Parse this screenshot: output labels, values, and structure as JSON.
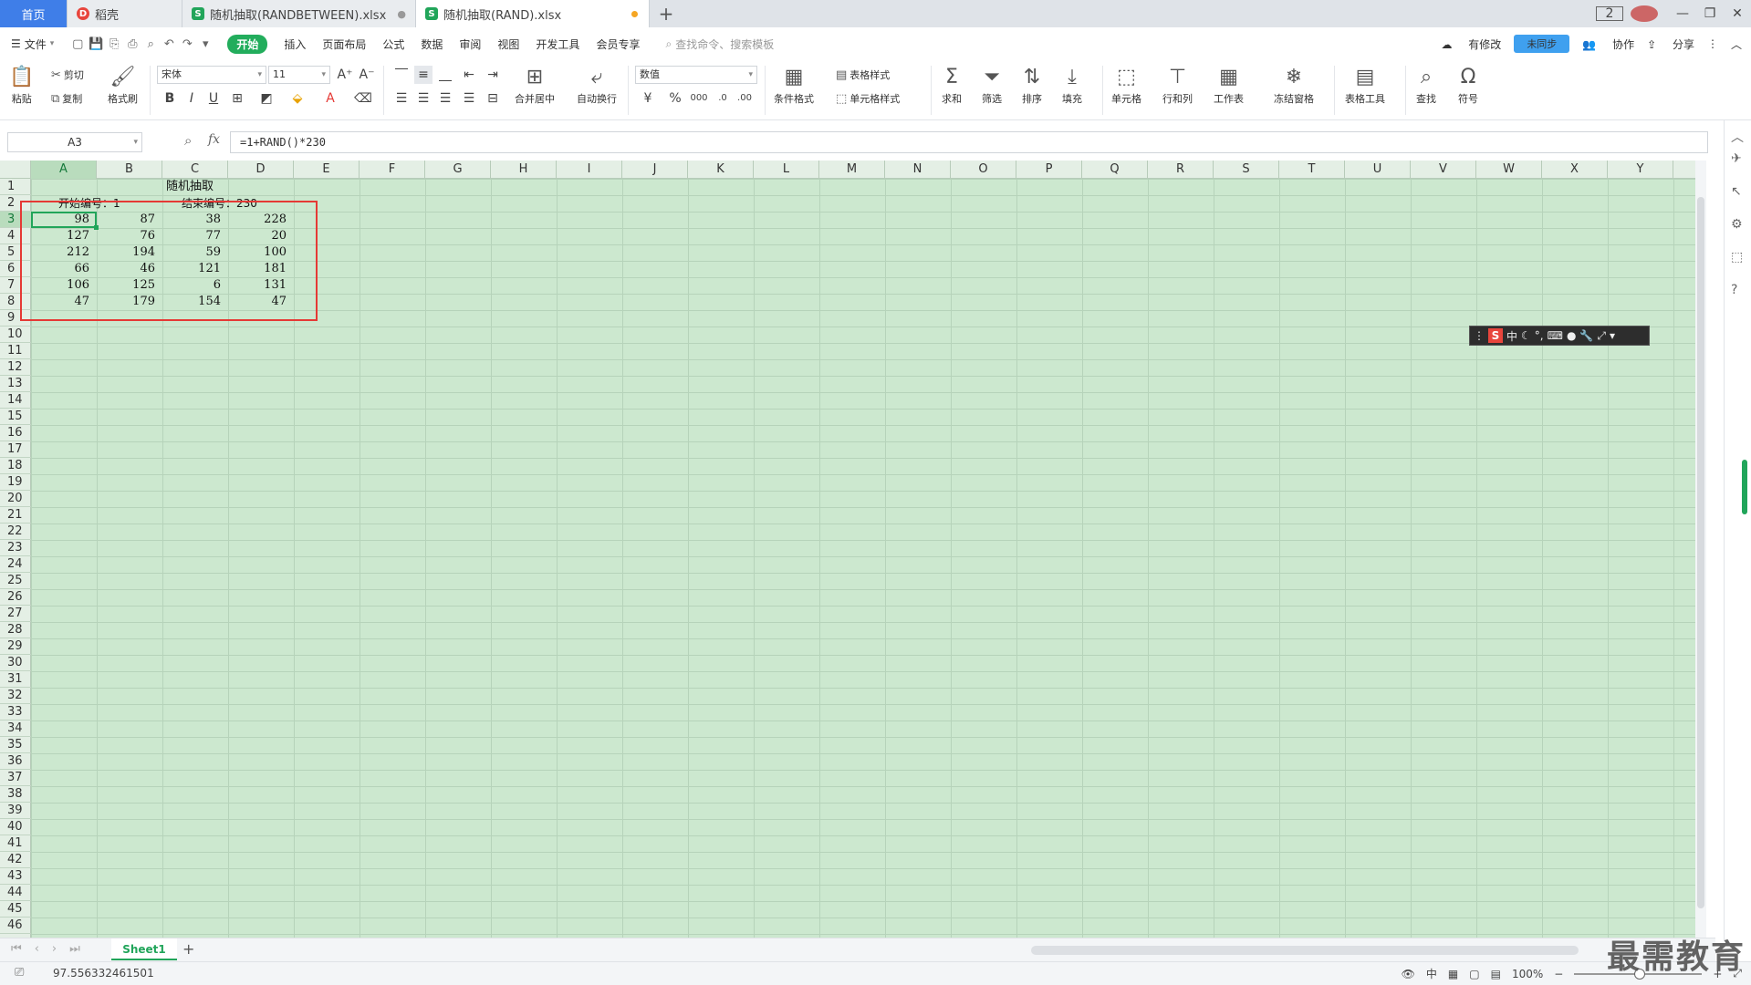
{
  "tabs": {
    "home": "首页",
    "daoke": "稻壳",
    "file1": "随机抽取(RANDBETWEEN).xlsx",
    "file2": "随机抽取(RAND).xlsx",
    "badge": "2"
  },
  "menu": {
    "file": "文件",
    "start": "开始",
    "items": [
      "插入",
      "页面布局",
      "公式",
      "数据",
      "审阅",
      "视图",
      "开发工具",
      "会员专享"
    ],
    "search": "查找命令、搜索模板",
    "cloud_label": "未同步",
    "sync": "有修改",
    "collab": "协作",
    "share": "分享"
  },
  "ribbon": {
    "paste": "粘贴",
    "cut": "剪切",
    "copy": "复制",
    "format_painter": "格式刷",
    "font_name": "宋体",
    "font_size": "11",
    "merge": "合并居中",
    "wrap": "自动换行",
    "number_format": "数值",
    "table_style": "表格样式",
    "cond_format": "条件格式",
    "cell_style": "单元格样式",
    "sum": "求和",
    "filter": "筛选",
    "sort": "排序",
    "fill": "填充",
    "cell": "单元格",
    "row_col": "行和列",
    "worksheet": "工作表",
    "freeze": "冻结窗格",
    "table_tools": "表格工具",
    "find": "查找",
    "symbol": "符号"
  },
  "formula_bar": {
    "name_box": "A3",
    "fx": "fx",
    "formula": "=1+RAND()*230"
  },
  "grid": {
    "columns": [
      "A",
      "B",
      "C",
      "D",
      "E",
      "F",
      "G",
      "H",
      "I",
      "J",
      "K",
      "L",
      "M",
      "N",
      "O",
      "P",
      "Q",
      "R",
      "S",
      "T",
      "U",
      "V",
      "W",
      "X",
      "Y"
    ],
    "rows": [
      "1",
      "2",
      "3",
      "4",
      "5",
      "6",
      "7",
      "8",
      "9",
      "10",
      "11",
      "12",
      "13",
      "14",
      "15",
      "16",
      "17",
      "18",
      "19",
      "20",
      "21",
      "22",
      "23",
      "24",
      "25",
      "26",
      "27",
      "28",
      "29",
      "30",
      "31",
      "32",
      "33",
      "34",
      "35",
      "36",
      "37",
      "38",
      "39",
      "40",
      "41",
      "42",
      "43",
      "44",
      "45",
      "46"
    ],
    "title": "随机抽取",
    "start_label": "开始编号：1",
    "end_label": "结束编号：230",
    "data": [
      [
        "98",
        "87",
        "38",
        "228"
      ],
      [
        "127",
        "76",
        "77",
        "20"
      ],
      [
        "212",
        "194",
        "59",
        "100"
      ],
      [
        "66",
        "46",
        "121",
        "181"
      ],
      [
        "106",
        "125",
        "6",
        "131"
      ],
      [
        "47",
        "179",
        "154",
        "47"
      ]
    ]
  },
  "ime": {
    "s": "S",
    "lang": "中",
    "punct": "°,"
  },
  "sheets": {
    "active": "Sheet1",
    "add": "+"
  },
  "status": {
    "value": "97.556332461501",
    "input_mode": "中",
    "zoom": "100%"
  },
  "watermark": "最需教育"
}
